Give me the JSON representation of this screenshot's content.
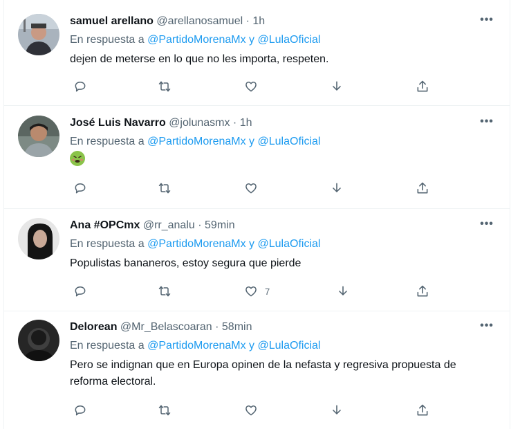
{
  "reply_to": {
    "prefix": "En respuesta a",
    "mention1": "@PartidoMorenaMx",
    "joiner": "y",
    "mention2": "@LulaOficial"
  },
  "more_label": "•••",
  "tweets": [
    {
      "name": "samuel arellano",
      "handle": "@arellanosamuel",
      "dot": "·",
      "time": "1h",
      "text": "dejen de meterse en lo que no les importa, respeten.",
      "likes": ""
    },
    {
      "name": "José Luis Navarro",
      "handle": "@jolunasmx",
      "dot": "·",
      "time": "1h",
      "text": "",
      "emoji": "nauseated-face-emoji",
      "likes": ""
    },
    {
      "name": "Ana #OPCmx",
      "handle": "@rr_analu",
      "dot": "·",
      "time": "59min",
      "text": "Populistas bananeros, estoy segura que pierde",
      "likes": "7"
    },
    {
      "name": "Delorean",
      "handle": "@Mr_Belascoaran",
      "dot": "·",
      "time": "58min",
      "text": "Pero se indignan que en Europa opinen de la nefasta y regresiva propuesta de reforma electoral.",
      "likes": ""
    }
  ],
  "icons": [
    "reply-icon",
    "retweet-icon",
    "like-icon",
    "download-icon",
    "share-icon",
    "more-icon"
  ],
  "colors": {
    "link": "#1d9bf0",
    "secondary": "#536471",
    "text": "#0f1419",
    "divider": "#eff3f4"
  }
}
